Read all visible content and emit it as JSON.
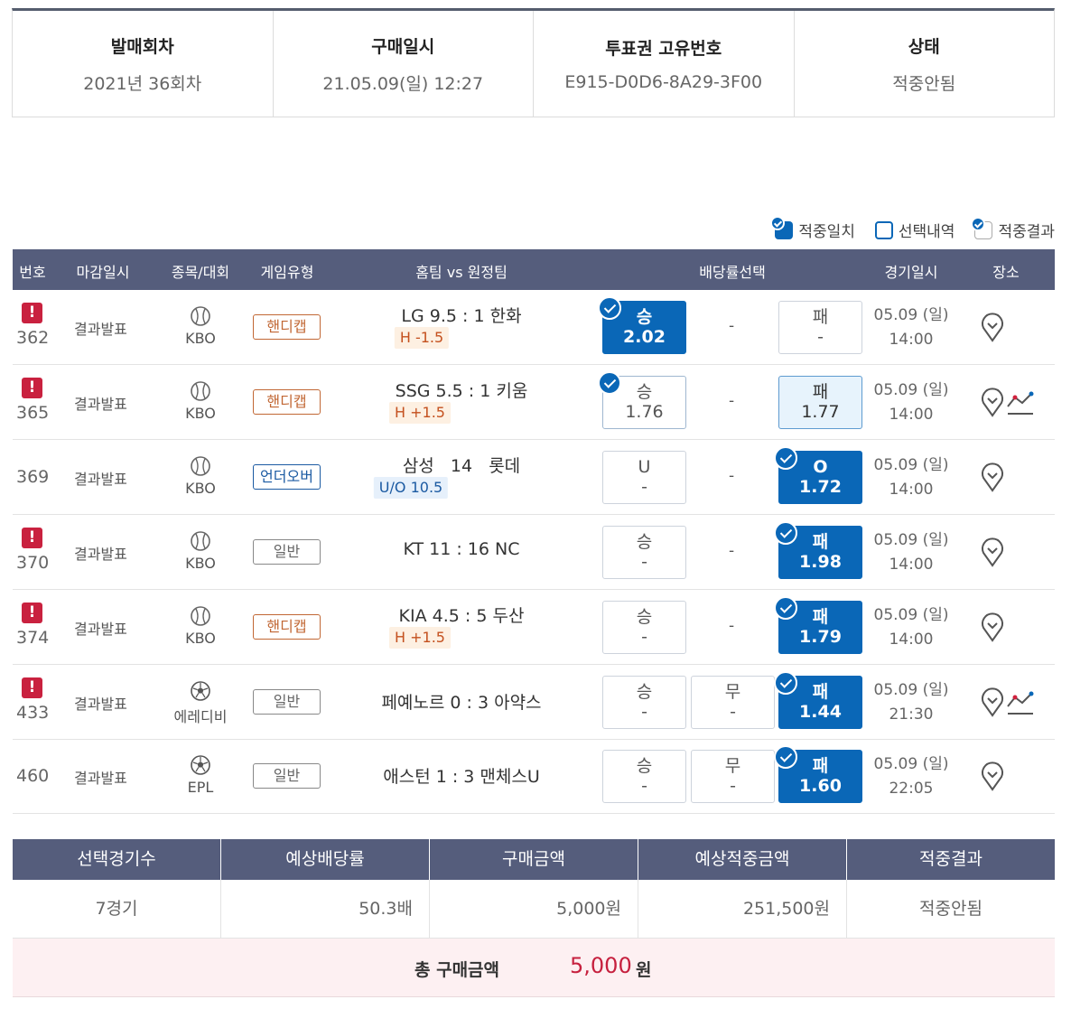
{
  "summary": [
    {
      "label": "발매회차",
      "value": "2021년 36회차"
    },
    {
      "label": "구매일시",
      "value": "21.05.09(일) 12:27"
    },
    {
      "label": "투표권 고유번호",
      "value": "E915-D0D6-8A29-3F00"
    },
    {
      "label": "상태",
      "value": "적중안됨"
    }
  ],
  "legend": {
    "match": "적중일치",
    "select": "선택내역",
    "result": "적중결과"
  },
  "columns": {
    "no": "번호",
    "close": "마감일시",
    "sport": "종목/대회",
    "gametype": "게임유형",
    "teams": "홈팀 vs 원정팀",
    "odds": "배당률선택",
    "date": "경기일시",
    "place": "장소"
  },
  "rows": [
    {
      "no": "362",
      "close": "결과발표",
      "league": "KBO",
      "gametype": "핸디캡",
      "teams": "LG 9.5 : 1 한화",
      "handicap": "H -1.5",
      "o1": {
        "label": "승",
        "value": "2.02"
      },
      "o2": "-",
      "o3": {
        "label": "패",
        "value": "-"
      },
      "date": "05.09 (일)",
      "time": "14:00"
    },
    {
      "no": "365",
      "close": "결과발표",
      "league": "KBO",
      "gametype": "핸디캡",
      "teams": "SSG 5.5 : 1 키움",
      "handicap": "H +1.5",
      "o1": {
        "label": "승",
        "value": "1.76"
      },
      "o2": "-",
      "o3": {
        "label": "패",
        "value": "1.77"
      },
      "date": "05.09 (일)",
      "time": "14:00"
    },
    {
      "no": "369",
      "close": "결과발표",
      "league": "KBO",
      "gametype": "언더오버",
      "teams": "삼성   14   롯데",
      "handicap": "U/O 10.5",
      "o1": {
        "label": "U",
        "value": "-"
      },
      "o2": "-",
      "o3": {
        "label": "O",
        "value": "1.72"
      },
      "date": "05.09 (일)",
      "time": "14:00"
    },
    {
      "no": "370",
      "close": "결과발표",
      "league": "KBO",
      "gametype": "일반",
      "teams": "KT 11 : 16 NC",
      "o1": {
        "label": "승",
        "value": "-"
      },
      "o2": "-",
      "o3": {
        "label": "패",
        "value": "1.98"
      },
      "date": "05.09 (일)",
      "time": "14:00"
    },
    {
      "no": "374",
      "close": "결과발표",
      "league": "KBO",
      "gametype": "핸디캡",
      "teams": "KIA 4.5 : 5 두산",
      "handicap": "H +1.5",
      "o1": {
        "label": "승",
        "value": "-"
      },
      "o2": "-",
      "o3": {
        "label": "패",
        "value": "1.79"
      },
      "date": "05.09 (일)",
      "time": "14:00"
    },
    {
      "no": "433",
      "close": "결과발표",
      "league": "에레디비",
      "gametype": "일반",
      "teams": "페예노르 0 : 3 아약스",
      "o1": {
        "label": "승",
        "value": "-"
      },
      "o2": {
        "label": "무",
        "value": "-"
      },
      "o3": {
        "label": "패",
        "value": "1.44"
      },
      "date": "05.09 (일)",
      "time": "21:30"
    },
    {
      "no": "460",
      "close": "결과발표",
      "league": "EPL",
      "gametype": "일반",
      "teams": "애스턴 1 : 3 맨체스U",
      "o1": {
        "label": "승",
        "value": "-"
      },
      "o2": {
        "label": "무",
        "value": "-"
      },
      "o3": {
        "label": "패",
        "value": "1.60"
      },
      "date": "05.09 (일)",
      "time": "22:05"
    }
  ],
  "bottom": {
    "headers": [
      "선택경기수",
      "예상배당률",
      "구매금액",
      "예상적중금액",
      "적중결과"
    ],
    "values": [
      "7경기",
      "50.3배",
      "5,000원",
      "251,500원",
      "적중안됨"
    ]
  },
  "total": {
    "label": "총 구매금액",
    "value": "5,000",
    "unit": "원"
  },
  "icons": {
    "alert": "alert-icon",
    "baseball": "baseball-icon",
    "soccer": "soccer-ball-icon",
    "pin": "map-pin-icon",
    "trend": "trend-chart-icon",
    "check": "check-badge-icon"
  },
  "colors": {
    "header_bg": "#555d7c",
    "selected": "#0a67b7",
    "alert": "#c9213f",
    "total_value": "#c6203e"
  }
}
